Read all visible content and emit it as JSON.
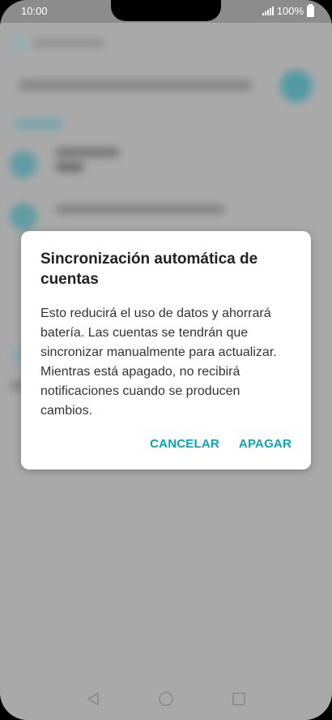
{
  "statusbar": {
    "time": "10:00",
    "battery": "100%"
  },
  "dialog": {
    "title": "Sincronización automática de cuentas",
    "body": "Esto reducirá el uso de datos y ahorrará batería. Las cuentas se tendrán que sincronizar manualmente para actualizar. Mientras está apagado, no recibirá notificaciones cuando se producen cambios.",
    "cancel_label": "CANCELAR",
    "confirm_label": "APAGAR",
    "accent_color": "#0aa3b8"
  },
  "navbar": {
    "icons": [
      "back-icon",
      "home-icon",
      "recents-icon"
    ]
  }
}
